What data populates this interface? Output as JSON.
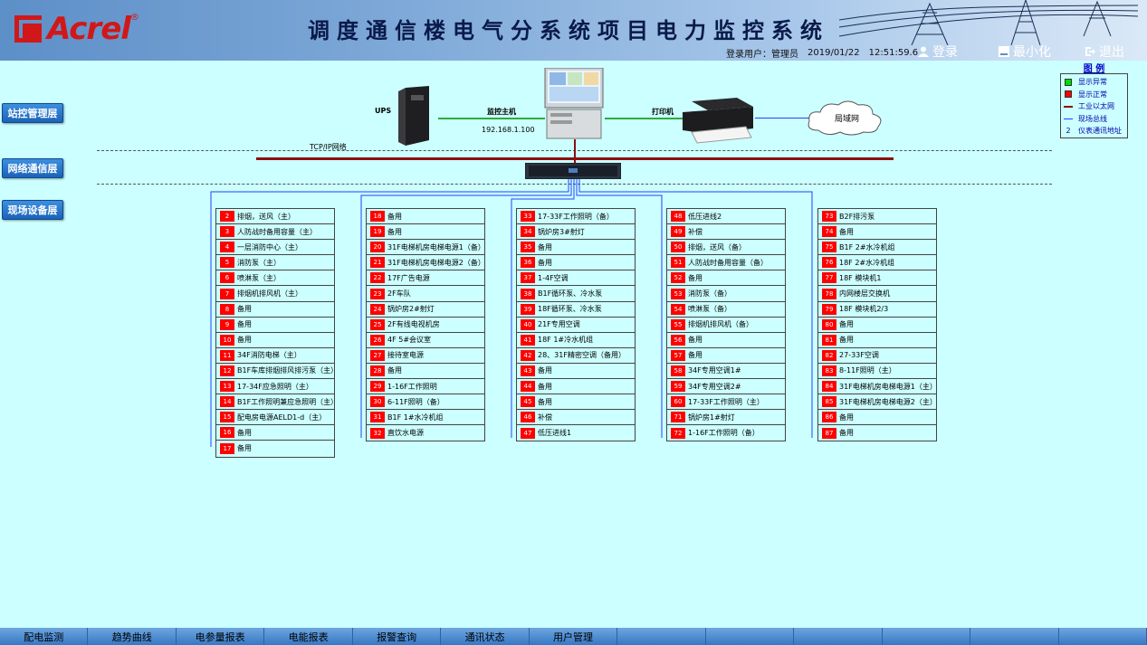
{
  "header": {
    "brand": "Acrel",
    "brand_mark": "®",
    "title": "调度通信楼电气分系统项目电力监控系统",
    "user_label": "登录用户：",
    "user_name": "管理员",
    "date": "2019/01/22",
    "time": "12:51:59.6",
    "login": "登录",
    "minimize": "最小化",
    "exit": "退出"
  },
  "layers": [
    "站控管理层",
    "网络通信层",
    "现场设备层"
  ],
  "legend": {
    "title": "图 例",
    "items": [
      {
        "label": "显示异常",
        "color": "#00dd00",
        "type": "square"
      },
      {
        "label": "显示正常",
        "color": "#ff0000",
        "type": "square"
      },
      {
        "label": "工业以太网",
        "color": "#8b0e0e",
        "type": "line"
      },
      {
        "label": "现场总线",
        "color": "#2040ff",
        "type": "line"
      },
      {
        "label": "仪表通讯地址",
        "mark": "2",
        "type": "text"
      }
    ]
  },
  "topology": {
    "ups": "UPS",
    "host": "监控主机",
    "ip": "192.168.1.100",
    "printer": "打印机",
    "lan": "局域网",
    "tcp": "TCP/IP网络"
  },
  "columns": [
    [
      {
        "n": "2",
        "t": "排烟，送风（主）"
      },
      {
        "n": "3",
        "t": "人防战时备用容量（主）"
      },
      {
        "n": "4",
        "t": "一层消防中心（主）"
      },
      {
        "n": "5",
        "t": "消防泵（主）"
      },
      {
        "n": "6",
        "t": "喷淋泵（主）"
      },
      {
        "n": "7",
        "t": "排烟机排风机（主）"
      },
      {
        "n": "8",
        "t": "备用"
      },
      {
        "n": "9",
        "t": "备用"
      },
      {
        "n": "10",
        "t": "备用"
      },
      {
        "n": "11",
        "t": "34F消防电梯（主）"
      },
      {
        "n": "12",
        "t": "B1F车库排烟排风排污泵（主）"
      },
      {
        "n": "13",
        "t": "17-34F应急照明（主）"
      },
      {
        "n": "14",
        "t": "B1F工作照明兼应急照明（主）"
      },
      {
        "n": "15",
        "t": "配电房电源AELD1-d（主）"
      },
      {
        "n": "16",
        "t": "备用"
      },
      {
        "n": "17",
        "t": "备用"
      }
    ],
    [
      {
        "n": "18",
        "t": "备用"
      },
      {
        "n": "19",
        "t": "备用"
      },
      {
        "n": "20",
        "t": "31F电梯机房电梯电源1（备）"
      },
      {
        "n": "21",
        "t": "31F电梯机房电梯电源2（备）"
      },
      {
        "n": "22",
        "t": "17F广告电源"
      },
      {
        "n": "23",
        "t": "2F车队"
      },
      {
        "n": "24",
        "t": "锅炉房2#射灯"
      },
      {
        "n": "25",
        "t": "2F有线电视机房"
      },
      {
        "n": "26",
        "t": "4F 5#会议室"
      },
      {
        "n": "27",
        "t": "接待室电源"
      },
      {
        "n": "28",
        "t": "备用"
      },
      {
        "n": "29",
        "t": "1-16F工作照明"
      },
      {
        "n": "30",
        "t": "6-11F照明（备）"
      },
      {
        "n": "31",
        "t": "B1F 1#水冷机组"
      },
      {
        "n": "32",
        "t": "直饮水电源"
      }
    ],
    [
      {
        "n": "33",
        "t": "17-33F工作照明（备）"
      },
      {
        "n": "34",
        "t": "锅炉房3#射灯"
      },
      {
        "n": "35",
        "t": "备用"
      },
      {
        "n": "36",
        "t": "备用"
      },
      {
        "n": "37",
        "t": "1-4F空调"
      },
      {
        "n": "38",
        "t": "B1F循环泵、冷水泵"
      },
      {
        "n": "39",
        "t": "18F循环泵、冷水泵"
      },
      {
        "n": "40",
        "t": "21F专用空调"
      },
      {
        "n": "41",
        "t": "18F 1#冷水机组"
      },
      {
        "n": "42",
        "t": "28、31F精密空调（备用）"
      },
      {
        "n": "43",
        "t": "备用"
      },
      {
        "n": "44",
        "t": "备用"
      },
      {
        "n": "45",
        "t": "备用"
      },
      {
        "n": "46",
        "t": "补偿"
      },
      {
        "n": "47",
        "t": "低压进线1"
      }
    ],
    [
      {
        "n": "48",
        "t": "低压进线2"
      },
      {
        "n": "49",
        "t": "补偿"
      },
      {
        "n": "50",
        "t": "排烟，送风（备）"
      },
      {
        "n": "51",
        "t": "人防战时备用容量（备）"
      },
      {
        "n": "52",
        "t": "备用"
      },
      {
        "n": "53",
        "t": "消防泵（备）"
      },
      {
        "n": "54",
        "t": "喷淋泵（备）"
      },
      {
        "n": "55",
        "t": "排烟机排风机（备）"
      },
      {
        "n": "56",
        "t": "备用"
      },
      {
        "n": "57",
        "t": "备用"
      },
      {
        "n": "58",
        "t": "34F专用空调1#"
      },
      {
        "n": "59",
        "t": "34F专用空调2#"
      },
      {
        "n": "60",
        "t": "17-33F工作照明（主）"
      },
      {
        "n": "71",
        "t": "锅炉房1#射灯"
      },
      {
        "n": "72",
        "t": "1-16F工作照明（备）"
      }
    ],
    [
      {
        "n": "73",
        "t": "B2F排污泵"
      },
      {
        "n": "74",
        "t": "备用"
      },
      {
        "n": "75",
        "t": "B1F 2#水冷机组"
      },
      {
        "n": "76",
        "t": "18F 2#水冷机组"
      },
      {
        "n": "77",
        "t": "18F 模块机1"
      },
      {
        "n": "78",
        "t": "内网楼层交换机"
      },
      {
        "n": "79",
        "t": "18F 模块机2/3"
      },
      {
        "n": "80",
        "t": "备用"
      },
      {
        "n": "81",
        "t": "备用"
      },
      {
        "n": "82",
        "t": "27-33F空调"
      },
      {
        "n": "83",
        "t": "8-11F照明（主）"
      },
      {
        "n": "84",
        "t": "31F电梯机房电梯电源1（主）"
      },
      {
        "n": "85",
        "t": "31F电梯机房电梯电源2（主）"
      },
      {
        "n": "86",
        "t": "备用"
      },
      {
        "n": "87",
        "t": "备用"
      }
    ]
  ],
  "footer_tabs": [
    "配电监测",
    "趋势曲线",
    "电参量报表",
    "电能报表",
    "报警查询",
    "通讯状态",
    "用户管理",
    "",
    "",
    "",
    "",
    "",
    ""
  ]
}
